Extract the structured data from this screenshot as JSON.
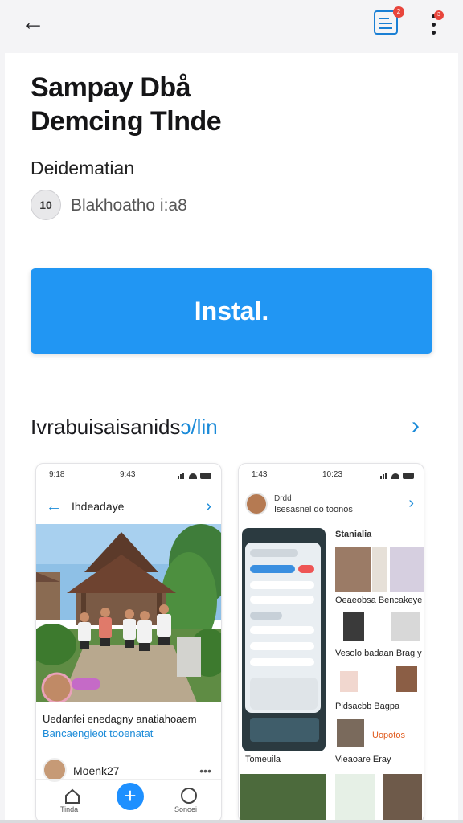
{
  "header": {
    "back_icon": "arrow-left-icon",
    "doc_icon": "document-icon",
    "doc_badge": "2",
    "more_icon": "more-vertical-icon",
    "more_badge": "3"
  },
  "app": {
    "title_line1": "Sampay Dbå",
    "title_line2": "Demcing Tlnde",
    "subtitle": "Deidematian",
    "developer_avatar_text": "10",
    "developer_name": "Blakhoatho i:a8",
    "install_label": "Instal."
  },
  "section": {
    "title": "Ivrabuisaisanids",
    "title_accent": "ɔ/lin",
    "arrow_icon": "chevron-right-icon"
  },
  "screenshot1": {
    "time_left": "9:18",
    "time_center": "9:43",
    "header_title": "Ihdeadaye",
    "caption_line1": "Uedanfei enedagny anatiahoaem",
    "caption_line2": "Bancaengieot tooenatat",
    "user_name": "Moenk27",
    "nav_home": "Tinda",
    "nav_search": "Sonoei"
  },
  "screenshot2": {
    "time_left": "1:43",
    "time_center": "10:23",
    "profile_name": "Drdd",
    "profile_sub": "Isesasnel do toonos",
    "grid_title": "Stanialia",
    "labels": [
      "Oeaeobsa Bencakeye",
      "Vesolo badaan Brag y",
      "Pidsacbb Bagpa",
      "Uopotos",
      "Tomeuila",
      "Vieaoare Eray"
    ]
  },
  "colors": {
    "accent": "#2196f3",
    "link": "#1a8ad8",
    "badge": "#e8453c"
  }
}
